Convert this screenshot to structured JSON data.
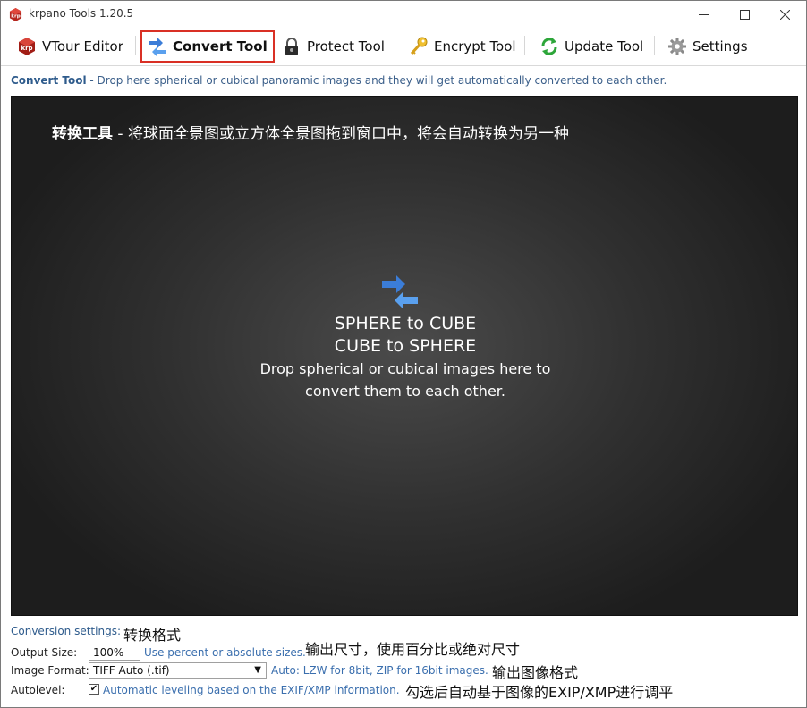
{
  "window": {
    "title": "krpano Tools 1.20.5"
  },
  "toolbar": {
    "items": [
      {
        "label": "VTour Editor",
        "icon": "krpano-logo-icon"
      },
      {
        "label": "Convert Tool",
        "icon": "convert-arrows-icon",
        "active": true
      },
      {
        "label": "Protect Tool",
        "icon": "padlock-icon"
      },
      {
        "label": "Encrypt Tool",
        "icon": "key-icon"
      },
      {
        "label": "Update Tool",
        "icon": "refresh-icon"
      },
      {
        "label": "Settings",
        "icon": "gear-icon"
      }
    ],
    "active_border_color": "#d93025"
  },
  "info": {
    "tool_name": "Convert Tool",
    "description": " - Drop here spherical or cubical panoramic images and they will get automatically converted to each other."
  },
  "dropzone": {
    "heading_bold": "转换工具",
    "heading_rest": " - 将球面全景图或立方体全景图拖到窗口中，将会自动转换为另一种",
    "line1": "SPHERE to CUBE",
    "line2": "CUBE to SPHERE",
    "line3": "Drop spherical or cubical images here to",
    "line4": "convert them to each other."
  },
  "settings": {
    "conversion_label": "Conversion settings:",
    "conversion_note": "转换格式",
    "output_size_label": "Output Size:",
    "output_size_value": "100%",
    "output_size_hint": "Use percent or absolute sizes.",
    "output_size_note": "输出尺寸，使用百分比或绝对尺寸",
    "image_format_label": "Image Format:",
    "image_format_value": "TIFF Auto (.tif)",
    "image_format_hint": "Auto: LZW for 8bit, ZIP for 16bit images.",
    "image_format_note": "输出图像格式",
    "autolevel_label": "Autolevel:",
    "autolevel_checked": true,
    "autolevel_hint": "Automatic leveling based on the EXIF/XMP information.",
    "autolevel_note": "勾选后自动基于图像的EXIP/XMP进行调平"
  }
}
